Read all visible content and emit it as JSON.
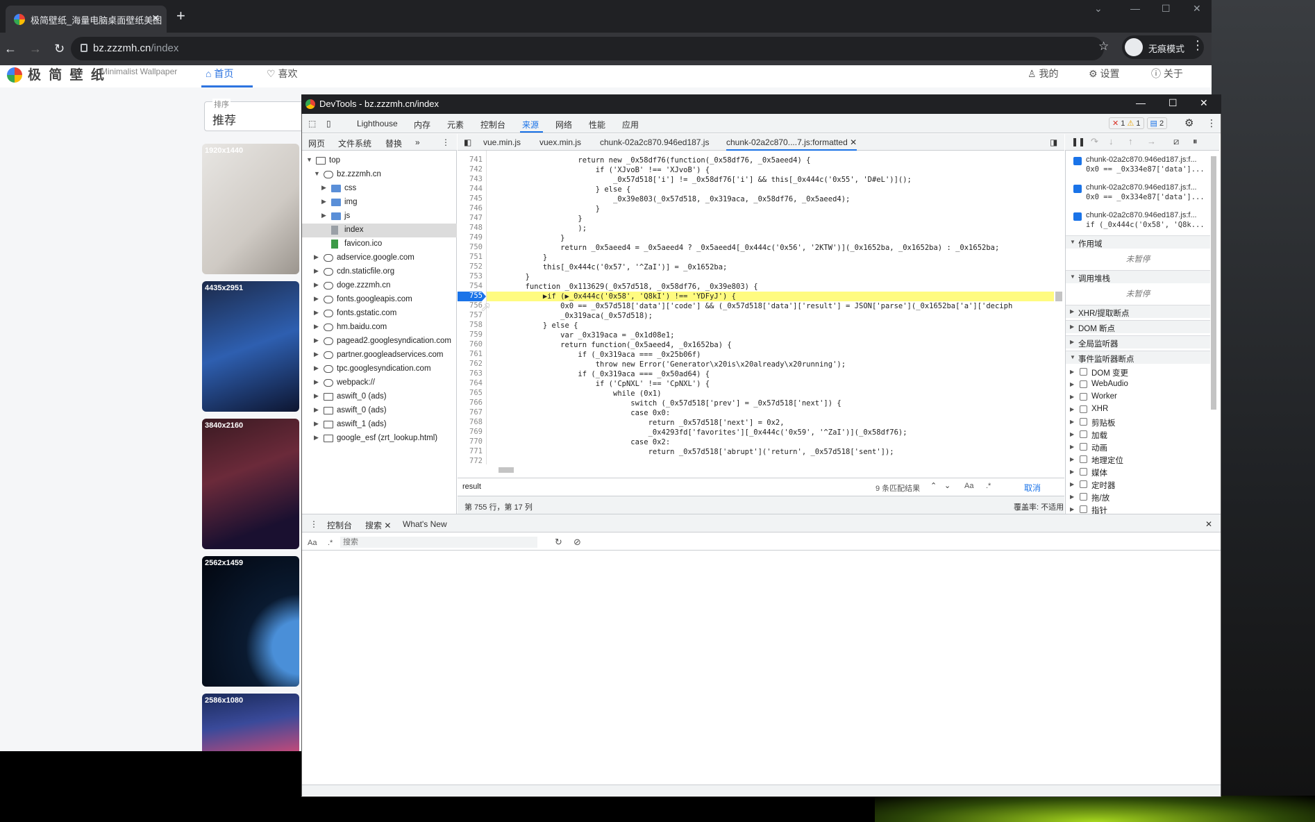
{
  "browser": {
    "tab_title": "极简壁纸_海量电脑桌面壁纸美图",
    "tab_close": "✕",
    "new_tab": "+",
    "url_host": "bz.zzzmh.cn",
    "url_path": "/index",
    "incognito_label": "无痕模式"
  },
  "site": {
    "name": "极 简 壁 纸",
    "subtitle": "Minimalist Wallpaper",
    "nav_home": "首页",
    "nav_fav": "喜欢",
    "nav_mine": "我的",
    "nav_settings": "设置",
    "nav_about": "关于",
    "sort_label": "排序",
    "sort_value": "推荐",
    "thumbs": [
      "1920x1440",
      "4435x2951",
      "3840x2160",
      "2562x1459",
      "2586x1080"
    ]
  },
  "devtools": {
    "title": "DevTools - bz.zzzmh.cn/index",
    "tabs": [
      "Lighthouse",
      "内存",
      "元素",
      "控制台",
      "来源",
      "网络",
      "性能",
      "应用"
    ],
    "errors": "1",
    "warnings": "1",
    "messages": "2",
    "navigator_tabs": [
      "网页",
      "文件系统",
      "替换",
      "»"
    ],
    "tree": [
      {
        "label": "top",
        "depth": 0,
        "kind": "frame",
        "open": true
      },
      {
        "label": "bz.zzzmh.cn",
        "depth": 1,
        "kind": "cloud",
        "open": true
      },
      {
        "label": "css",
        "depth": 2,
        "kind": "folder",
        "open": false
      },
      {
        "label": "img",
        "depth": 2,
        "kind": "folder",
        "open": false
      },
      {
        "label": "js",
        "depth": 2,
        "kind": "folder",
        "open": false
      },
      {
        "label": "index",
        "depth": 2,
        "kind": "file",
        "selected": true
      },
      {
        "label": "favicon.ico",
        "depth": 2,
        "kind": "filegreen"
      },
      {
        "label": "adservice.google.com",
        "depth": 1,
        "kind": "cloud",
        "open": false
      },
      {
        "label": "cdn.staticfile.org",
        "depth": 1,
        "kind": "cloud",
        "open": false
      },
      {
        "label": "doge.zzzmh.cn",
        "depth": 1,
        "kind": "cloud",
        "open": false
      },
      {
        "label": "fonts.googleapis.com",
        "depth": 1,
        "kind": "cloud",
        "open": false
      },
      {
        "label": "fonts.gstatic.com",
        "depth": 1,
        "kind": "cloud",
        "open": false
      },
      {
        "label": "hm.baidu.com",
        "depth": 1,
        "kind": "cloud",
        "open": false
      },
      {
        "label": "pagead2.googlesyndication.com",
        "depth": 1,
        "kind": "cloud",
        "open": false
      },
      {
        "label": "partner.googleadservices.com",
        "depth": 1,
        "kind": "cloud",
        "open": false
      },
      {
        "label": "tpc.googlesyndication.com",
        "depth": 1,
        "kind": "cloud",
        "open": false
      },
      {
        "label": "webpack://",
        "depth": 1,
        "kind": "cloud",
        "open": false
      },
      {
        "label": "aswift_0 (ads)",
        "depth": 1,
        "kind": "frame",
        "open": false
      },
      {
        "label": "aswift_0 (ads)",
        "depth": 1,
        "kind": "frame",
        "open": false
      },
      {
        "label": "aswift_1 (ads)",
        "depth": 1,
        "kind": "frame",
        "open": false
      },
      {
        "label": "google_esf (zrt_lookup.html)",
        "depth": 1,
        "kind": "frame",
        "open": false
      }
    ],
    "file_tabs": [
      "vue.min.js",
      "vuex.min.js",
      "chunk-02a2c870.946ed187.js",
      "chunk-02a2c870....7.js:formatted"
    ],
    "code_lines": [
      {
        "n": "741",
        "t": "                    return new _0x58df76(function(_0x58df76, _0x5aeed4) {"
      },
      {
        "n": "742",
        "t": "                        if ('XJvoB' !== 'XJvoB') {"
      },
      {
        "n": "743",
        "t": "                            _0x57d518['i'] != _0x58df76['i'] && this[_0x444c('0x55', 'D#eL')]();"
      },
      {
        "n": "744",
        "t": "                        } else {"
      },
      {
        "n": "745",
        "t": "                            _0x39e803(_0x57d518, _0x319aca, _0x58df76, _0x5aeed4);"
      },
      {
        "n": "746",
        "t": "                        }"
      },
      {
        "n": "747",
        "t": "                    }"
      },
      {
        "n": "748",
        "t": "                    );"
      },
      {
        "n": "749",
        "t": "                }"
      },
      {
        "n": "750",
        "t": "                return _0x5aeed4 = _0x5aeed4 ? _0x5aeed4[_0x444c('0x56', '2KTW')](_0x1652ba, _0x1652ba) : _0x1652ba;"
      },
      {
        "n": "751",
        "t": "            }"
      },
      {
        "n": "752",
        "t": "            this[_0x444c('0x57', '^ZaI')] = _0x1652ba;"
      },
      {
        "n": "753",
        "t": "        }"
      },
      {
        "n": "754",
        "t": "        function _0x113629(_0x57d518, _0x58df76, _0x39e803) {"
      },
      {
        "n": "755",
        "t": "            ▶if (▶_0x444c('0x58', 'Q8kI') !== 'YDFyJ') {"
      },
      {
        "n": "756",
        "t": "                0x0 == _0x57d518['data']['code'] && (_0x57d518['data']['result'] = JSON['parse'](_0x1652ba['a']['deciph"
      },
      {
        "n": "757",
        "t": "                _0x319aca(_0x57d518);"
      },
      {
        "n": "758",
        "t": "            } else {"
      },
      {
        "n": "759",
        "t": "                var _0x319aca = _0x1d08e1;"
      },
      {
        "n": "760",
        "t": "                return function(_0x5aeed4, _0x1652ba) {"
      },
      {
        "n": "761",
        "t": "                    if (_0x319aca === _0x25b06f)"
      },
      {
        "n": "762",
        "t": "                        throw new Error('Generator\\x20is\\x20already\\x20running');"
      },
      {
        "n": "763",
        "t": "                    if (_0x319aca === _0x50ad64) {"
      },
      {
        "n": "764",
        "t": "                        if ('CpNXL' !== 'CpNXL') {"
      },
      {
        "n": "765",
        "t": "                            while (0x1)"
      },
      {
        "n": "766",
        "t": "                                switch (_0x57d518['prev'] = _0x57d518['next']) {"
      },
      {
        "n": "767",
        "t": "                                case 0x0:"
      },
      {
        "n": "768",
        "t": "                                    return _0x57d518['next'] = 0x2,"
      },
      {
        "n": "769",
        "t": "                                    _0x4293fd['favorites'][_0x444c('0x59', '^ZaI')](_0x58df76);"
      },
      {
        "n": "770",
        "t": "                                case 0x2:"
      },
      {
        "n": "771",
        "t": "                                    return _0x57d518['abrupt']('return', _0x57d518['sent']);"
      },
      {
        "n": "772",
        "t": ""
      }
    ],
    "search_query": "result",
    "search_count": "9 条匹配结果",
    "search_cancel": "取消",
    "status_pos": "第 755 行，第 17 列",
    "status_coverage": "覆盖率: 不适用",
    "breakpoints": [
      {
        "file": "chunk-02a2c870.946ed187.js:f...",
        "code": "0x0 == _0x334e87['data']..."
      },
      {
        "file": "chunk-02a2c870.946ed187.js:f...",
        "code": "0x0 == _0x334e87['data']..."
      },
      {
        "file": "chunk-02a2c870.946ed187.js:f...",
        "code": "if (_0x444c('0x58', 'Q8k..."
      }
    ],
    "scope_title": "作用域",
    "not_paused": "未暂停",
    "callstack_title": "调用堆栈",
    "xhr_title": "XHR/提取断点",
    "dom_bp_title": "DOM 断点",
    "global_title": "全局监听器",
    "event_title": "事件监听器断点",
    "events": [
      "DOM 变更",
      "WebAudio",
      "Worker",
      "XHR",
      "剪贴板",
      "加载",
      "动画",
      "地理定位",
      "媒体",
      "定时器",
      "拖/放",
      "指针"
    ],
    "drawer_tabs": [
      "控制台",
      "搜索",
      "What's New"
    ],
    "drawer_search_placeholder": "搜索"
  }
}
